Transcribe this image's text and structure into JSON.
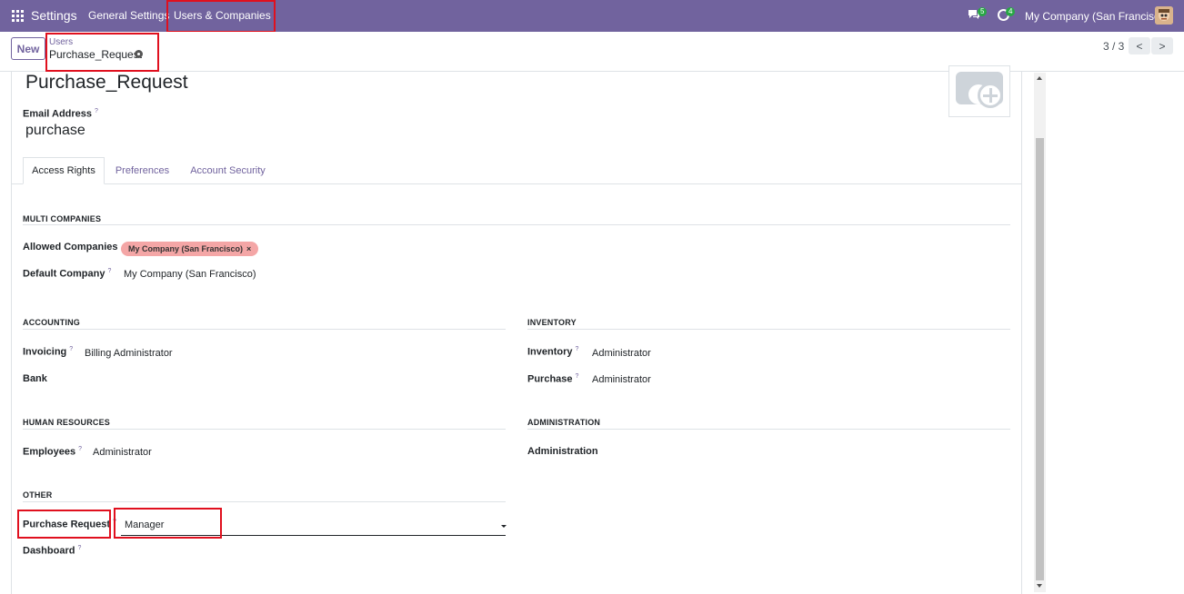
{
  "navbar": {
    "brand": "Settings",
    "menu": [
      "General Settings",
      "Users & Companies"
    ],
    "messages_count": "5",
    "activities_count": "4",
    "company": "My Company (San Francisco)"
  },
  "control_panel": {
    "new_label": "New",
    "breadcrumb_parent": "Users",
    "breadcrumb_current": "Purchase_Request",
    "pager": "3 / 3",
    "prev": "<",
    "next": ">"
  },
  "form": {
    "name": "Purchase_Request",
    "email_label": "Email Address",
    "email_value": "purchase",
    "help_mark": "?",
    "tabs": [
      "Access Rights",
      "Preferences",
      "Account Security"
    ],
    "multi_companies": {
      "title": "MULTI COMPANIES",
      "allowed_label": "Allowed Companies",
      "allowed_tag": "My Company (San Francisco)",
      "tag_remove": "×",
      "default_label": "Default Company",
      "default_value": "My Company (San Francisco)"
    },
    "accounting": {
      "title": "ACCOUNTING",
      "invoicing_label": "Invoicing",
      "invoicing_value": "Billing Administrator",
      "bank_label": "Bank"
    },
    "inventory": {
      "title": "INVENTORY",
      "inventory_label": "Inventory",
      "inventory_value": "Administrator",
      "purchase_label": "Purchase",
      "purchase_value": "Administrator"
    },
    "human_resources": {
      "title": "HUMAN RESOURCES",
      "employees_label": "Employees",
      "employees_value": "Administrator"
    },
    "administration": {
      "title": "ADMINISTRATION",
      "administration_label": "Administration"
    },
    "other": {
      "title": "OTHER",
      "purchase_request_label": "Purchase Request",
      "purchase_request_value": "Manager",
      "dashboard_label": "Dashboard"
    }
  },
  "colors": {
    "navbar": "#71639e",
    "highlight": "#e0101e",
    "tag": "#f4a6a6",
    "badge": "#28a745"
  }
}
